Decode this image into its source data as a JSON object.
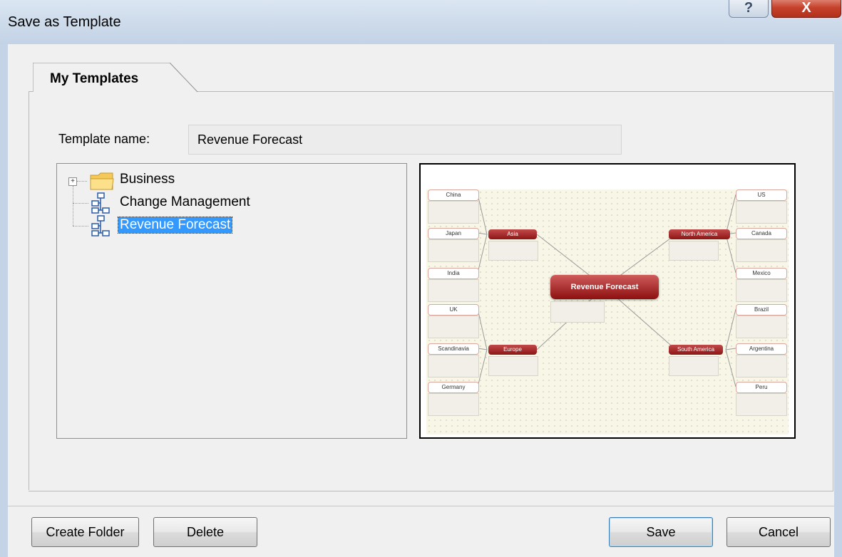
{
  "window": {
    "title": "Save as Template",
    "help_label": "?",
    "close_label": "X"
  },
  "tabs": [
    {
      "label": "My Templates"
    }
  ],
  "form": {
    "template_name_label": "Template name:",
    "template_name_value": "Revenue Forecast"
  },
  "tree": {
    "items": [
      {
        "label": "Business",
        "icon": "folder-icon",
        "expander": "+"
      },
      {
        "label": "Change Management",
        "icon": "mindmap-template-icon"
      },
      {
        "label": "Revenue Forecast",
        "icon": "mindmap-template-icon",
        "selected": true
      }
    ]
  },
  "preview": {
    "center": "Revenue Forecast",
    "regions": [
      "Asia",
      "Europe",
      "North America",
      "South America"
    ],
    "leaves_left": [
      "China",
      "Japan",
      "India",
      "UK",
      "Scandinavia",
      "Germany"
    ],
    "leaves_right": [
      "US",
      "Canada",
      "Mexico",
      "Brazil",
      "Argentina",
      "Peru"
    ]
  },
  "buttons": {
    "create_folder": "Create Folder",
    "delete": "Delete",
    "save": "Save",
    "cancel": "Cancel"
  },
  "colors": {
    "selection": "#3399ff",
    "node_red": "#a31e1e",
    "titlebar": "#cfdceb"
  }
}
